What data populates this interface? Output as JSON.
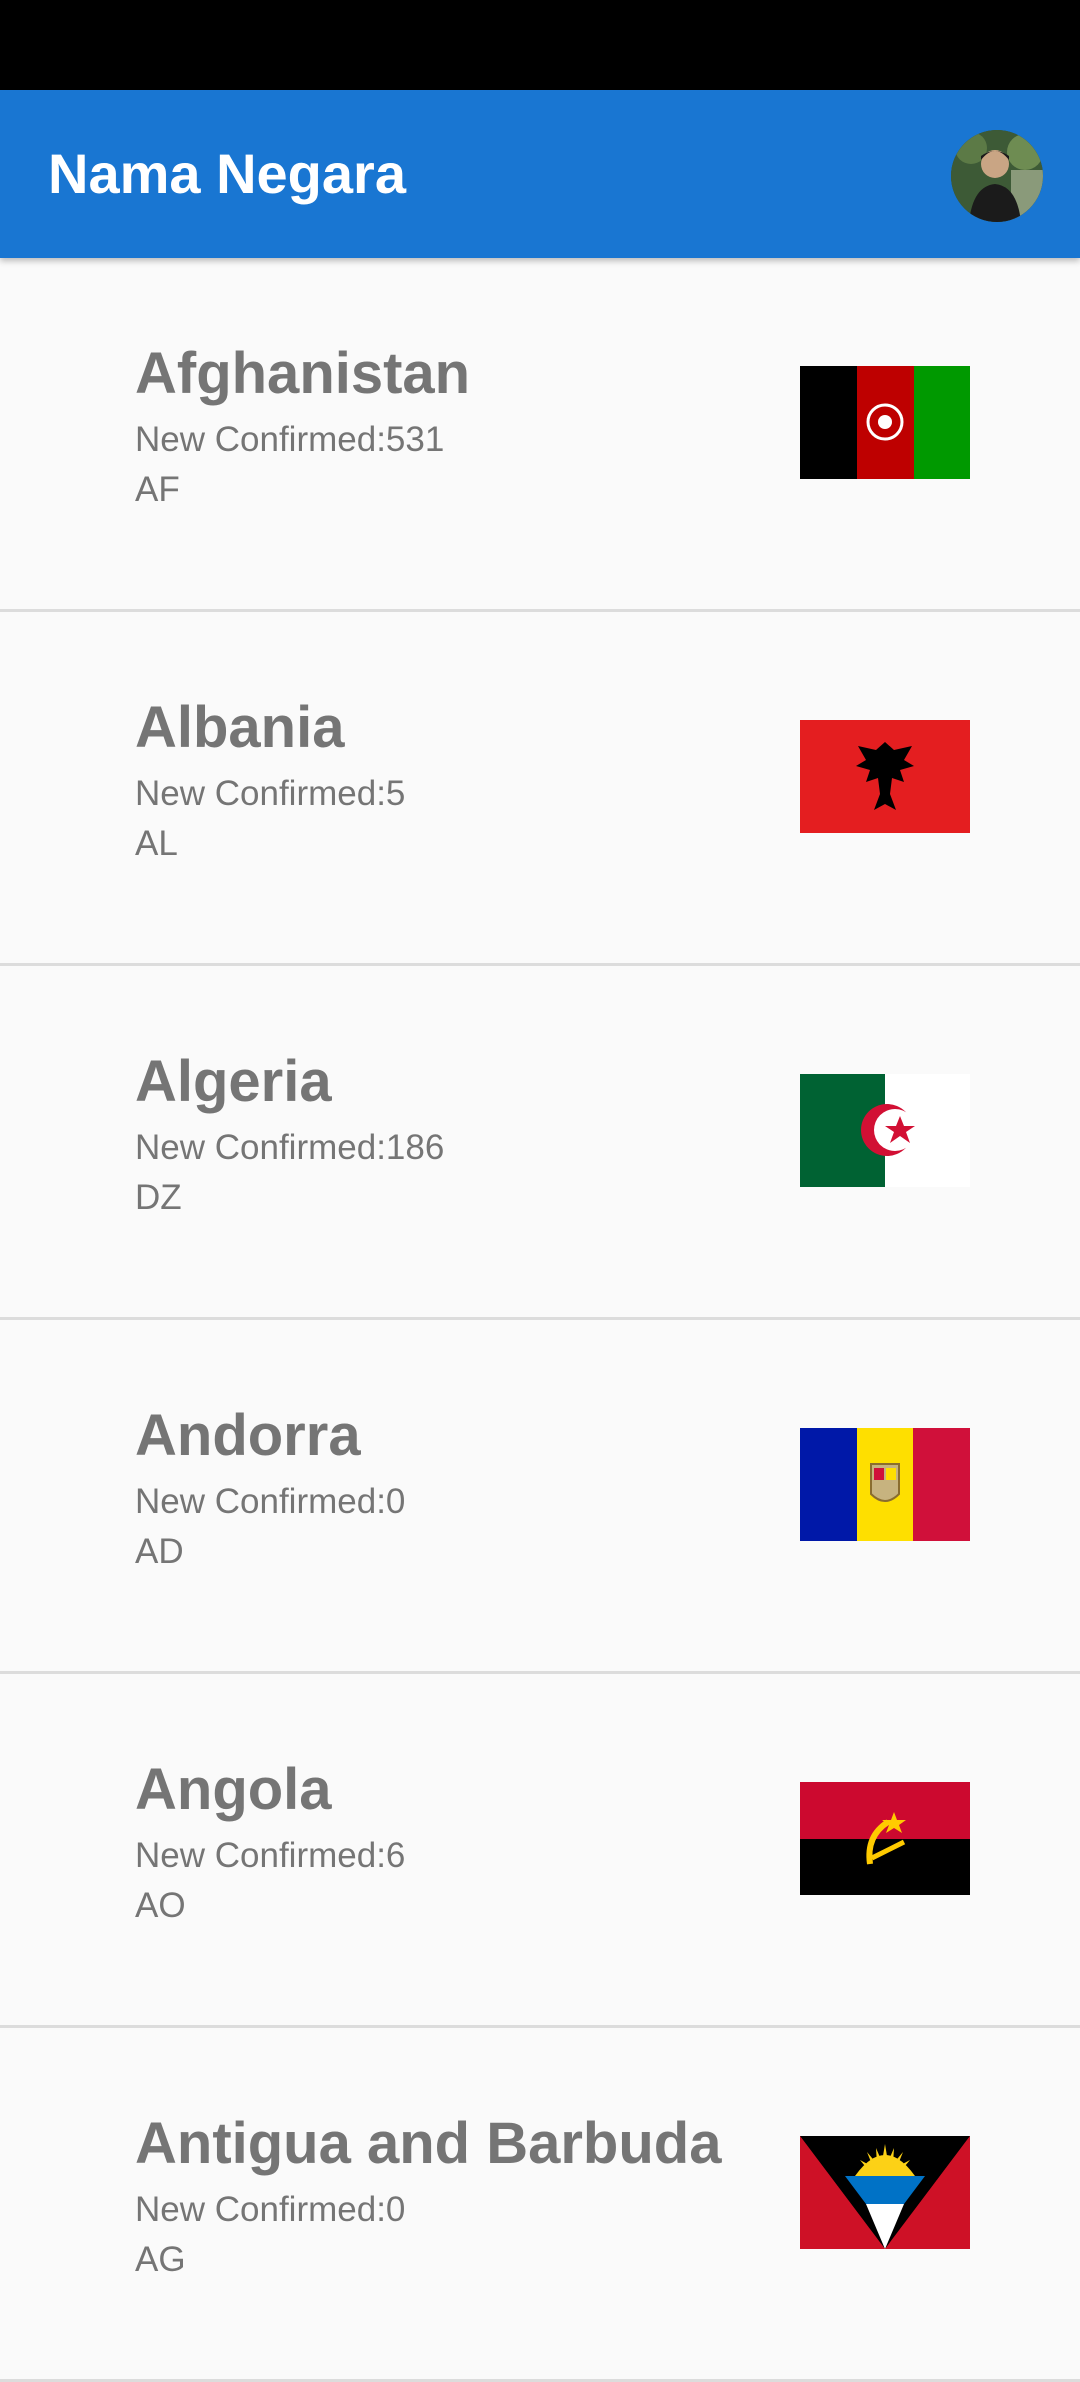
{
  "app_bar": {
    "title": "Nama Negara",
    "background_color": "#1976d2",
    "avatar_icon": "user-avatar-photo"
  },
  "countries": [
    {
      "name": "Afghanistan",
      "new_confirmed": "New Confirmed:531",
      "code": "AF",
      "flag_icon": "afghanistan-flag-icon"
    },
    {
      "name": "Albania",
      "new_confirmed": "New Confirmed:5",
      "code": "AL",
      "flag_icon": "albania-flag-icon"
    },
    {
      "name": "Algeria",
      "new_confirmed": "New Confirmed:186",
      "code": "DZ",
      "flag_icon": "algeria-flag-icon"
    },
    {
      "name": "Andorra",
      "new_confirmed": "New Confirmed:0",
      "code": "AD",
      "flag_icon": "andorra-flag-icon"
    },
    {
      "name": "Angola",
      "new_confirmed": "New Confirmed:6",
      "code": "AO",
      "flag_icon": "angola-flag-icon"
    },
    {
      "name": "Antigua and Barbuda",
      "new_confirmed": "New Confirmed:0",
      "code": "AG",
      "flag_icon": "antigua-and-barbuda-flag-icon"
    }
  ]
}
